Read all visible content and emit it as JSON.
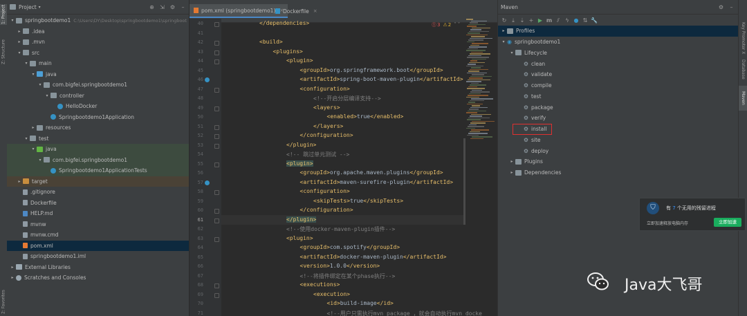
{
  "left_stripe": {
    "tabs": [
      "1: Project",
      "Z: Structure"
    ],
    "bottom_tab": "2: Favorites"
  },
  "project": {
    "title": "Project",
    "dropdown_icon": "chevron-down-icon",
    "rows": [
      {
        "indent": 0,
        "arrow": "▾",
        "icon": "folder",
        "label": "springbootdemo1",
        "hint": "C:\\Users\\DY\\Desktop\\springbootdemo1\\springboot",
        "bg": ""
      },
      {
        "indent": 1,
        "arrow": "▸",
        "icon": "folder",
        "label": ".idea",
        "bg": ""
      },
      {
        "indent": 1,
        "arrow": "▸",
        "icon": "folder",
        "label": ".mvn",
        "bg": ""
      },
      {
        "indent": 1,
        "arrow": "▾",
        "icon": "folder",
        "label": "src",
        "bg": ""
      },
      {
        "indent": 2,
        "arrow": "▾",
        "icon": "folder",
        "label": "main",
        "bg": ""
      },
      {
        "indent": 3,
        "arrow": "▾",
        "icon": "folder-src",
        "label": "java",
        "bg": ""
      },
      {
        "indent": 4,
        "arrow": "▾",
        "icon": "folder",
        "label": "com.bigfei.springbootdemo1",
        "bg": ""
      },
      {
        "indent": 5,
        "arrow": "▾",
        "icon": "folder",
        "label": "controller",
        "bg": ""
      },
      {
        "indent": 6,
        "arrow": "",
        "icon": "java",
        "label": "HelloDocker",
        "bg": ""
      },
      {
        "indent": 5,
        "arrow": "",
        "icon": "java",
        "label": "Springbootdemo1Application",
        "bg": ""
      },
      {
        "indent": 3,
        "arrow": "▸",
        "icon": "folder",
        "label": "resources",
        "bg": ""
      },
      {
        "indent": 2,
        "arrow": "▾",
        "icon": "folder",
        "label": "test",
        "bg": ""
      },
      {
        "indent": 3,
        "arrow": "▾",
        "icon": "folder-test",
        "label": "java",
        "bg": "green"
      },
      {
        "indent": 4,
        "arrow": "▾",
        "icon": "folder",
        "label": "com.bigfei.springbootdemo1",
        "bg": "green"
      },
      {
        "indent": 5,
        "arrow": "",
        "icon": "java",
        "label": "Springbootdemo1ApplicationTests",
        "bg": "green"
      },
      {
        "indent": 1,
        "arrow": "▸",
        "icon": "folder-target",
        "label": "target",
        "bg": "brown"
      },
      {
        "indent": 1,
        "arrow": "",
        "icon": "file",
        "label": ".gitignore",
        "bg": ""
      },
      {
        "indent": 1,
        "arrow": "",
        "icon": "file",
        "label": "Dockerfile",
        "bg": ""
      },
      {
        "indent": 1,
        "arrow": "",
        "icon": "md",
        "label": "HELP.md",
        "bg": ""
      },
      {
        "indent": 1,
        "arrow": "",
        "icon": "file",
        "label": "mvnw",
        "bg": ""
      },
      {
        "indent": 1,
        "arrow": "",
        "icon": "file",
        "label": "mvnw.cmd",
        "bg": ""
      },
      {
        "indent": 1,
        "arrow": "",
        "icon": "xml",
        "label": "pom.xml",
        "bg": "selected"
      },
      {
        "indent": 1,
        "arrow": "",
        "icon": "file",
        "label": "springbootdemo1.iml",
        "bg": ""
      },
      {
        "indent": 0,
        "arrow": "▸",
        "icon": "lib",
        "label": "External Libraries",
        "bg": ""
      },
      {
        "indent": 0,
        "arrow": "▸",
        "icon": "scratch",
        "label": "Scratches and Consoles",
        "bg": ""
      }
    ]
  },
  "editor": {
    "tabs": [
      {
        "label": "pom.xml (springbootdemo1)",
        "active": true
      },
      {
        "label": "Dockerfile",
        "active": false
      }
    ],
    "inspections": {
      "errors": "3",
      "warnings": "2"
    },
    "current_line": 61,
    "lines": [
      {
        "n": 40,
        "indent": 2,
        "parts": [
          [
            "tag",
            "</dependencies>"
          ]
        ]
      },
      {
        "n": 41,
        "indent": 0,
        "parts": []
      },
      {
        "n": 42,
        "indent": 2,
        "parts": [
          [
            "tag",
            "<build>"
          ]
        ]
      },
      {
        "n": 43,
        "indent": 3,
        "parts": [
          [
            "tag",
            "<plugins>"
          ]
        ]
      },
      {
        "n": 44,
        "indent": 4,
        "parts": [
          [
            "tag",
            "<plugin>"
          ]
        ]
      },
      {
        "n": 45,
        "indent": 5,
        "parts": [
          [
            "tag",
            "<groupId>"
          ],
          [
            "txt",
            "org.springframework.boot"
          ],
          [
            "tag",
            "</groupId>"
          ]
        ]
      },
      {
        "n": 46,
        "indent": 5,
        "parts": [
          [
            "tag",
            "<artifactId>"
          ],
          [
            "txt",
            "spring-boot-maven-plugin"
          ],
          [
            "tag",
            "</artifactId>"
          ]
        ]
      },
      {
        "n": 47,
        "indent": 5,
        "parts": [
          [
            "tag",
            "<configuration>"
          ]
        ]
      },
      {
        "n": 48,
        "indent": 6,
        "parts": [
          [
            "cmt",
            "<!--开启分层编译支持-->"
          ]
        ]
      },
      {
        "n": 49,
        "indent": 6,
        "parts": [
          [
            "tag",
            "<layers>"
          ]
        ]
      },
      {
        "n": 50,
        "indent": 7,
        "parts": [
          [
            "tag",
            "<enabled>"
          ],
          [
            "txt",
            "true"
          ],
          [
            "tag",
            "</enabled>"
          ]
        ]
      },
      {
        "n": 51,
        "indent": 6,
        "parts": [
          [
            "tag",
            "</layers>"
          ]
        ]
      },
      {
        "n": 52,
        "indent": 5,
        "parts": [
          [
            "tag",
            "</configuration>"
          ]
        ]
      },
      {
        "n": 53,
        "indent": 4,
        "parts": [
          [
            "tag",
            "</plugin>"
          ]
        ]
      },
      {
        "n": 54,
        "indent": 4,
        "parts": [
          [
            "cmt",
            "<!-- 跳过单元测试 -->"
          ]
        ]
      },
      {
        "n": 55,
        "indent": 4,
        "parts": [
          [
            "hl",
            "<plugin>"
          ]
        ]
      },
      {
        "n": 56,
        "indent": 5,
        "parts": [
          [
            "tag",
            "<groupId>"
          ],
          [
            "txt",
            "org.apache.maven.plugins"
          ],
          [
            "tag",
            "</groupId>"
          ]
        ]
      },
      {
        "n": 57,
        "indent": 5,
        "parts": [
          [
            "tag",
            "<artifactId>"
          ],
          [
            "txt",
            "maven-surefire-plugin"
          ],
          [
            "tag",
            "</artifactId>"
          ]
        ]
      },
      {
        "n": 58,
        "indent": 5,
        "parts": [
          [
            "tag",
            "<configuration>"
          ]
        ]
      },
      {
        "n": 59,
        "indent": 6,
        "parts": [
          [
            "tag",
            "<skipTests>"
          ],
          [
            "txt",
            "true"
          ],
          [
            "tag",
            "</skipTests>"
          ]
        ]
      },
      {
        "n": 60,
        "indent": 5,
        "parts": [
          [
            "tag",
            "</configuration>"
          ]
        ]
      },
      {
        "n": 61,
        "indent": 4,
        "parts": [
          [
            "hl",
            "</plugin>"
          ]
        ]
      },
      {
        "n": 62,
        "indent": 4,
        "parts": [
          [
            "cmt",
            "<!--使用docker-maven-plugin插件-->"
          ]
        ]
      },
      {
        "n": 63,
        "indent": 4,
        "parts": [
          [
            "tag",
            "<plugin>"
          ]
        ]
      },
      {
        "n": 64,
        "indent": 5,
        "parts": [
          [
            "tag",
            "<groupId>"
          ],
          [
            "txt",
            "com.spotify"
          ],
          [
            "tag",
            "</groupId>"
          ]
        ]
      },
      {
        "n": 65,
        "indent": 5,
        "parts": [
          [
            "tag",
            "<artifactId>"
          ],
          [
            "txt",
            "docker-maven-plugin"
          ],
          [
            "tag",
            "</artifactId>"
          ]
        ]
      },
      {
        "n": 66,
        "indent": 5,
        "parts": [
          [
            "tag",
            "<version>"
          ],
          [
            "txt",
            "1.0.0"
          ],
          [
            "tag",
            "</version>"
          ]
        ]
      },
      {
        "n": 67,
        "indent": 5,
        "parts": [
          [
            "cmt",
            "<!--将插件绑定在某个phase执行-->"
          ]
        ]
      },
      {
        "n": 68,
        "indent": 5,
        "parts": [
          [
            "tag",
            "<executions>"
          ]
        ]
      },
      {
        "n": 69,
        "indent": 6,
        "parts": [
          [
            "tag",
            "<execution>"
          ]
        ]
      },
      {
        "n": 70,
        "indent": 7,
        "parts": [
          [
            "tag",
            "<id>"
          ],
          [
            "txt",
            "build-image"
          ],
          [
            "tag",
            "</id>"
          ]
        ]
      },
      {
        "n": 71,
        "indent": 7,
        "parts": [
          [
            "cmt",
            "<!--用户只需执行mvn package ，就会自动执行mvn docke"
          ]
        ]
      }
    ]
  },
  "maven": {
    "title": "Maven",
    "rows": [
      {
        "indent": 0,
        "arrow": "▸",
        "icon": "folder-icon",
        "label": "Profiles",
        "selected": true
      },
      {
        "indent": 0,
        "arrow": "▾",
        "icon": "maven-icon",
        "label": "springbootdemo1",
        "selected": false
      },
      {
        "indent": 1,
        "arrow": "▾",
        "icon": "folder-icon",
        "label": "Lifecycle",
        "selected": false
      },
      {
        "indent": 2,
        "arrow": "",
        "icon": "gear-icon",
        "label": "clean",
        "selected": false
      },
      {
        "indent": 2,
        "arrow": "",
        "icon": "gear-icon",
        "label": "validate",
        "selected": false
      },
      {
        "indent": 2,
        "arrow": "",
        "icon": "gear-icon",
        "label": "compile",
        "selected": false
      },
      {
        "indent": 2,
        "arrow": "",
        "icon": "gear-icon",
        "label": "test",
        "selected": false
      },
      {
        "indent": 2,
        "arrow": "",
        "icon": "gear-icon",
        "label": "package",
        "selected": false
      },
      {
        "indent": 2,
        "arrow": "",
        "icon": "gear-icon",
        "label": "verify",
        "selected": false
      },
      {
        "indent": 2,
        "arrow": "",
        "icon": "gear-icon",
        "label": "install",
        "selected": false
      },
      {
        "indent": 2,
        "arrow": "",
        "icon": "gear-icon",
        "label": "site",
        "selected": false
      },
      {
        "indent": 2,
        "arrow": "",
        "icon": "gear-icon",
        "label": "deploy",
        "selected": false
      },
      {
        "indent": 1,
        "arrow": "▸",
        "icon": "folder-icon",
        "label": "Plugins",
        "selected": false
      },
      {
        "indent": 1,
        "arrow": "▸",
        "icon": "folder-icon",
        "label": "Dependencies",
        "selected": false
      }
    ]
  },
  "right_stripe": {
    "tabs": [
      "Key Promoter X",
      "Database",
      "Maven"
    ]
  },
  "notification": {
    "prefix": "有 ",
    "count": "7",
    "suffix": " 个无用的残留进程",
    "subtitle": "立即加速释放电脑内存",
    "button": "立即加速"
  },
  "watermark": {
    "text": "Java大飞哥"
  },
  "colors": {
    "accent": "#4a88c7",
    "highlight_red": "#e03030",
    "tag": "#e8bf6a",
    "comment": "#808080"
  }
}
